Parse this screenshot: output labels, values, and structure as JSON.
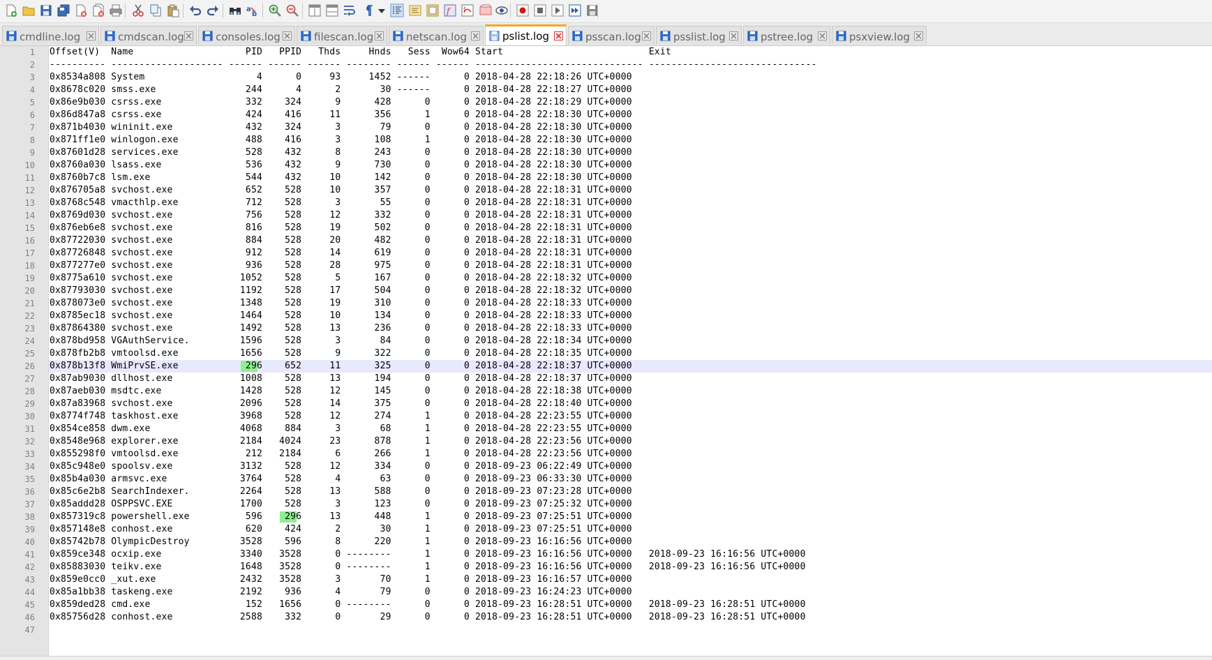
{
  "toolbar": {
    "buttons": [
      {
        "name": "new-file-icon",
        "x": "a"
      },
      {
        "name": "open-file-icon"
      },
      {
        "name": "save-icon"
      },
      {
        "name": "save-all-icon"
      },
      {
        "name": "close-icon"
      },
      {
        "name": "close-all-icon"
      },
      {
        "name": "print-icon"
      },
      {
        "name": "cut-icon"
      },
      {
        "name": "copy-icon"
      },
      {
        "name": "paste-icon"
      },
      {
        "name": "undo-icon"
      },
      {
        "name": "redo-icon"
      },
      {
        "name": "find-icon"
      },
      {
        "name": "replace-icon"
      },
      {
        "name": "zoom-in-icon"
      },
      {
        "name": "zoom-out-icon"
      },
      {
        "name": "sync-vertical-icon"
      },
      {
        "name": "sync-horizontal-icon"
      },
      {
        "name": "word-wrap-icon"
      },
      {
        "name": "show-all-characters-icon"
      },
      {
        "name": "dropdown-icon"
      },
      {
        "name": "indent-guide-icon"
      },
      {
        "name": "user-language-icon"
      },
      {
        "name": "doc-map-icon"
      },
      {
        "name": "function-list-icon"
      },
      {
        "name": "folder-as-workspace-icon"
      },
      {
        "name": "document-list-icon"
      },
      {
        "name": "monitoring-icon"
      },
      {
        "name": "record-macro-icon"
      },
      {
        "name": "stop-macro-icon"
      },
      {
        "name": "play-macro-icon"
      },
      {
        "name": "run-macro-multiple-icon"
      },
      {
        "name": "save-macro-icon"
      }
    ]
  },
  "tabs": [
    {
      "label": "cmdline.log",
      "active": false
    },
    {
      "label": "cmdscan.log",
      "active": false
    },
    {
      "label": "consoles.log",
      "active": false
    },
    {
      "label": "filescan.log",
      "active": false
    },
    {
      "label": "netscan.log",
      "active": false
    },
    {
      "label": "pslist.log",
      "active": true
    },
    {
      "label": "psscan.log",
      "active": false
    },
    {
      "label": "psslist.log",
      "active": false
    },
    {
      "label": "pstree.log",
      "active": false
    },
    {
      "label": "psxview.log",
      "active": false
    }
  ],
  "editor": {
    "current_line": 26,
    "lines": [
      "Offset(V)  Name                    PID   PPID   Thds     Hnds   Sess  Wow64 Start                          Exit",
      "---------- -------------------- ------ ------ ------ -------- ------ ------ ------------------------------ ------------------------------",
      "0x8534a808 System                    4      0     93     1452 ------      0 2018-04-28 22:18:26 UTC+0000",
      "0x8678c020 smss.exe                244      4      2       30 ------      0 2018-04-28 22:18:27 UTC+0000",
      "0x86e9b030 csrss.exe               332    324      9      428      0      0 2018-04-28 22:18:29 UTC+0000",
      "0x86d847a8 csrss.exe               424    416     11      356      1      0 2018-04-28 22:18:30 UTC+0000",
      "0x871b4030 wininit.exe             432    324      3       79      0      0 2018-04-28 22:18:30 UTC+0000",
      "0x871ff1e0 winlogon.exe            488    416      3      108      1      0 2018-04-28 22:18:30 UTC+0000",
      "0x87601d28 services.exe            528    432      8      243      0      0 2018-04-28 22:18:30 UTC+0000",
      "0x8760a030 lsass.exe               536    432      9      730      0      0 2018-04-28 22:18:30 UTC+0000",
      "0x8760b7c8 lsm.exe                 544    432     10      142      0      0 2018-04-28 22:18:30 UTC+0000",
      "0x876705a8 svchost.exe             652    528     10      357      0      0 2018-04-28 22:18:31 UTC+0000",
      "0x8768c548 vmacthlp.exe            712    528      3       55      0      0 2018-04-28 22:18:31 UTC+0000",
      "0x8769d030 svchost.exe             756    528     12      332      0      0 2018-04-28 22:18:31 UTC+0000",
      "0x876eb6e8 svchost.exe             816    528     19      502      0      0 2018-04-28 22:18:31 UTC+0000",
      "0x87722030 svchost.exe             884    528     20      482      0      0 2018-04-28 22:18:31 UTC+0000",
      "0x87726848 svchost.exe             912    528     14      619      0      0 2018-04-28 22:18:31 UTC+0000",
      "0x877277e0 svchost.exe             936    528     28      975      0      0 2018-04-28 22:18:31 UTC+0000",
      "0x8775a610 svchost.exe            1052    528      5      167      0      0 2018-04-28 22:18:32 UTC+0000",
      "0x87793030 svchost.exe            1192    528     17      504      0      0 2018-04-28 22:18:32 UTC+0000",
      "0x878073e0 svchost.exe            1348    528     19      310      0      0 2018-04-28 22:18:33 UTC+0000",
      "0x8785ec18 svchost.exe            1464    528     10      134      0      0 2018-04-28 22:18:33 UTC+0000",
      "0x87864380 svchost.exe            1492    528     13      236      0      0 2018-04-28 22:18:33 UTC+0000",
      "0x878bd958 VGAuthService.         1596    528      3       84      0      0 2018-04-28 22:18:34 UTC+0000",
      "0x878fb2b8 vmtoolsd.exe           1656    528      9      322      0      0 2018-04-28 22:18:35 UTC+0000",
      "0x878b13f8 WmiPrvSE.exe            296    652     11      325      0      0 2018-04-28 22:18:37 UTC+0000",
      "0x87ab9030 dllhost.exe            1008    528     13      194      0      0 2018-04-28 22:18:37 UTC+0000",
      "0x87aeb030 msdtc.exe              1428    528     12      145      0      0 2018-04-28 22:18:38 UTC+0000",
      "0x87a83968 svchost.exe            2096    528     14      375      0      0 2018-04-28 22:18:40 UTC+0000",
      "0x8774f748 taskhost.exe           3968    528     12      274      1      0 2018-04-28 22:23:55 UTC+0000",
      "0x854ce858 dwm.exe                4068    884      3       68      1      0 2018-04-28 22:23:55 UTC+0000",
      "0x8548e968 explorer.exe           2184   4024     23      878      1      0 2018-04-28 22:23:56 UTC+0000",
      "0x855298f0 vmtoolsd.exe            212   2184      6      266      1      0 2018-04-28 22:23:56 UTC+0000",
      "0x85c948e0 spoolsv.exe            3132    528     12      334      0      0 2018-09-23 06:22:49 UTC+0000",
      "0x85b4a030 armsvc.exe             3764    528      4       63      0      0 2018-09-23 06:33:30 UTC+0000",
      "0x85c6e2b8 SearchIndexer.         2264    528     13      588      0      0 2018-09-23 07:23:28 UTC+0000",
      "0x85addd28 OSPPSVC.EXE            1700    528      3      123      0      0 2018-09-23 07:25:32 UTC+0000",
      "0x857319c8 powershell.exe          596    296     13      448      1      0 2018-09-23 07:25:51 UTC+0000",
      "0x857148e8 conhost.exe             620    424      2       30      1      0 2018-09-23 07:25:51 UTC+0000",
      "0x85742b78 OlympicDestroy         3528    596      8      220      1      0 2018-09-23 16:16:56 UTC+0000",
      "0x859ce348 ocxip.exe              3340   3528      0 --------      1      0 2018-09-23 16:16:56 UTC+0000   2018-09-23 16:16:56 UTC+0000",
      "0x85883030 teikv.exe              1648   3528      0 --------      1      0 2018-09-23 16:16:56 UTC+0000   2018-09-23 16:16:56 UTC+0000",
      "0x859e0cc0 _xut.exe               2432   3528      3       70      1      0 2018-09-23 16:16:57 UTC+0000",
      "0x85a1bb38 taskeng.exe            2192    936      4       79      0      0 2018-09-23 16:24:23 UTC+0000",
      "0x859ded28 cmd.exe                 152   1656      0 --------      0      0 2018-09-23 16:28:51 UTC+0000   2018-09-23 16:28:51 UTC+0000",
      "0x85756d28 conhost.exe            2588    332      0       29      0      0 2018-09-23 16:28:51 UTC+0000   2018-09-23 16:28:51 UTC+0000",
      ""
    ],
    "highlights": [
      {
        "line": 26,
        "col": 34,
        "len": 3,
        "text": "296"
      },
      {
        "line": 38,
        "col": 41,
        "len": 3,
        "text": "296"
      }
    ],
    "colors": {
      "highlight": "#8ff08f",
      "current_line": "#e8e8ff",
      "active_tab_accent": "#f6a623"
    }
  }
}
